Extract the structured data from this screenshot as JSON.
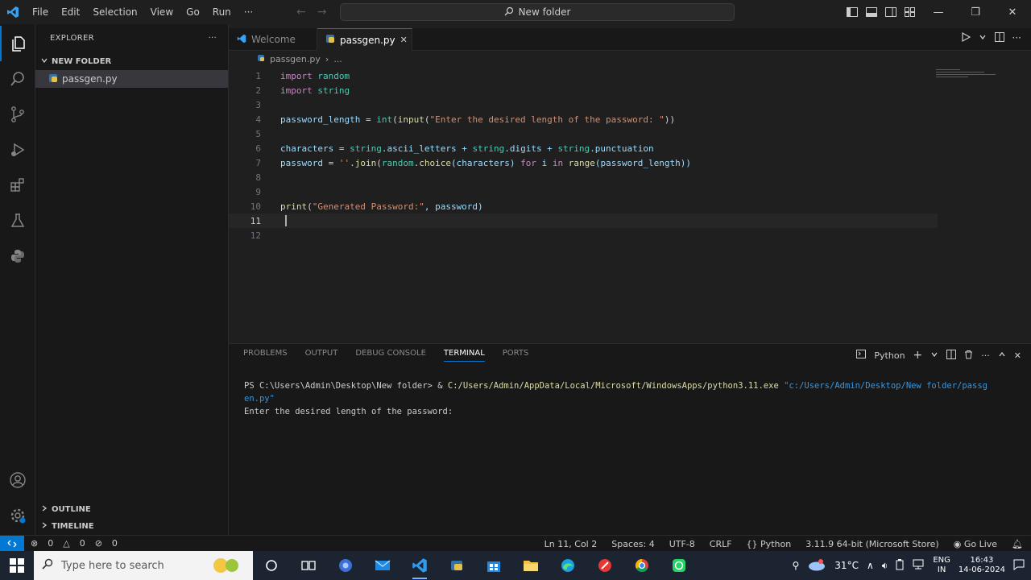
{
  "menu": [
    "File",
    "Edit",
    "Selection",
    "View",
    "Go",
    "Run",
    "···"
  ],
  "command_center": "New folder",
  "window_controls": {
    "minimize": "—",
    "maximize": "❐",
    "close": "✕"
  },
  "sidebar": {
    "title": "EXPLORER",
    "more": "···",
    "folder": "NEW FOLDER",
    "file": "passgen.py",
    "outline": "OUTLINE",
    "timeline": "TIMELINE"
  },
  "tabs": [
    {
      "label": "Welcome"
    },
    {
      "label": "passgen.py",
      "close": "✕"
    }
  ],
  "breadcrumb": {
    "file": "passgen.py",
    "rest": "..."
  },
  "code_lines": [
    {
      "n": "1"
    },
    {
      "n": "2"
    },
    {
      "n": "3"
    },
    {
      "n": "4"
    },
    {
      "n": "5"
    },
    {
      "n": "6"
    },
    {
      "n": "7"
    },
    {
      "n": "8"
    },
    {
      "n": "9"
    },
    {
      "n": "10"
    },
    {
      "n": "11"
    },
    {
      "n": "12"
    }
  ],
  "code": {
    "l1a": "import",
    "l1b": "random",
    "l2a": "import",
    "l2b": "string",
    "l4a": "password_length",
    "l4b": " = ",
    "l4c": "int",
    "l4d": "(",
    "l4e": "input",
    "l4f": "(",
    "l4g": "\"Enter the desired length of the password: \"",
    "l4h": "))",
    "l6a": "characters",
    "l6b": " = ",
    "l6c": "string",
    "l6d": ".ascii_letters + ",
    "l6e": "string",
    "l6f": ".digits + ",
    "l6g": "string",
    "l6h": ".punctuation",
    "l7a": "password",
    "l7b": " = ",
    "l7c": "''",
    "l7d": ".",
    "l7e": "join",
    "l7f": "(",
    "l7g": "random",
    "l7h": ".",
    "l7i": "choice",
    "l7j": "(characters) ",
    "l7k": "for",
    "l7l": " i ",
    "l7m": "in",
    "l7n": " ",
    "l7o": "range",
    "l7p": "(password_length))",
    "l10a": "print",
    "l10b": "(",
    "l10c": "\"Generated Password:\"",
    "l10d": ", password)"
  },
  "panel": {
    "tabs": [
      "PROBLEMS",
      "OUTPUT",
      "DEBUG CONSOLE",
      "TERMINAL",
      "PORTS"
    ],
    "active_tab": "TERMINAL",
    "shell": "Python",
    "add": "+"
  },
  "terminal": {
    "prompt": "PS C:\\Users\\Admin\\Desktop\\New folder> & ",
    "exe": "C:/Users/Admin/AppData/Local/Microsoft/WindowsApps/python3.11.exe",
    "arg1": " \"c:/Users/Admin/Desktop/New folder/passg",
    "arg2": "en.py\"",
    "output": "Enter the desired length of the password:"
  },
  "status": {
    "errors": "0",
    "warnings": "0",
    "ports": "0",
    "position": "Ln 11, Col 2",
    "spaces": "Spaces: 4",
    "encoding": "UTF-8",
    "eol": "CRLF",
    "language": "Python",
    "interpreter": "3.11.9 64-bit (Microsoft Store)",
    "golive": "Go Live"
  },
  "taskbar": {
    "search_placeholder": "Type here to search",
    "weather": "31°C",
    "lang1": "ENG",
    "lang2": "IN",
    "time": "16:43",
    "date": "14-06-2024"
  }
}
